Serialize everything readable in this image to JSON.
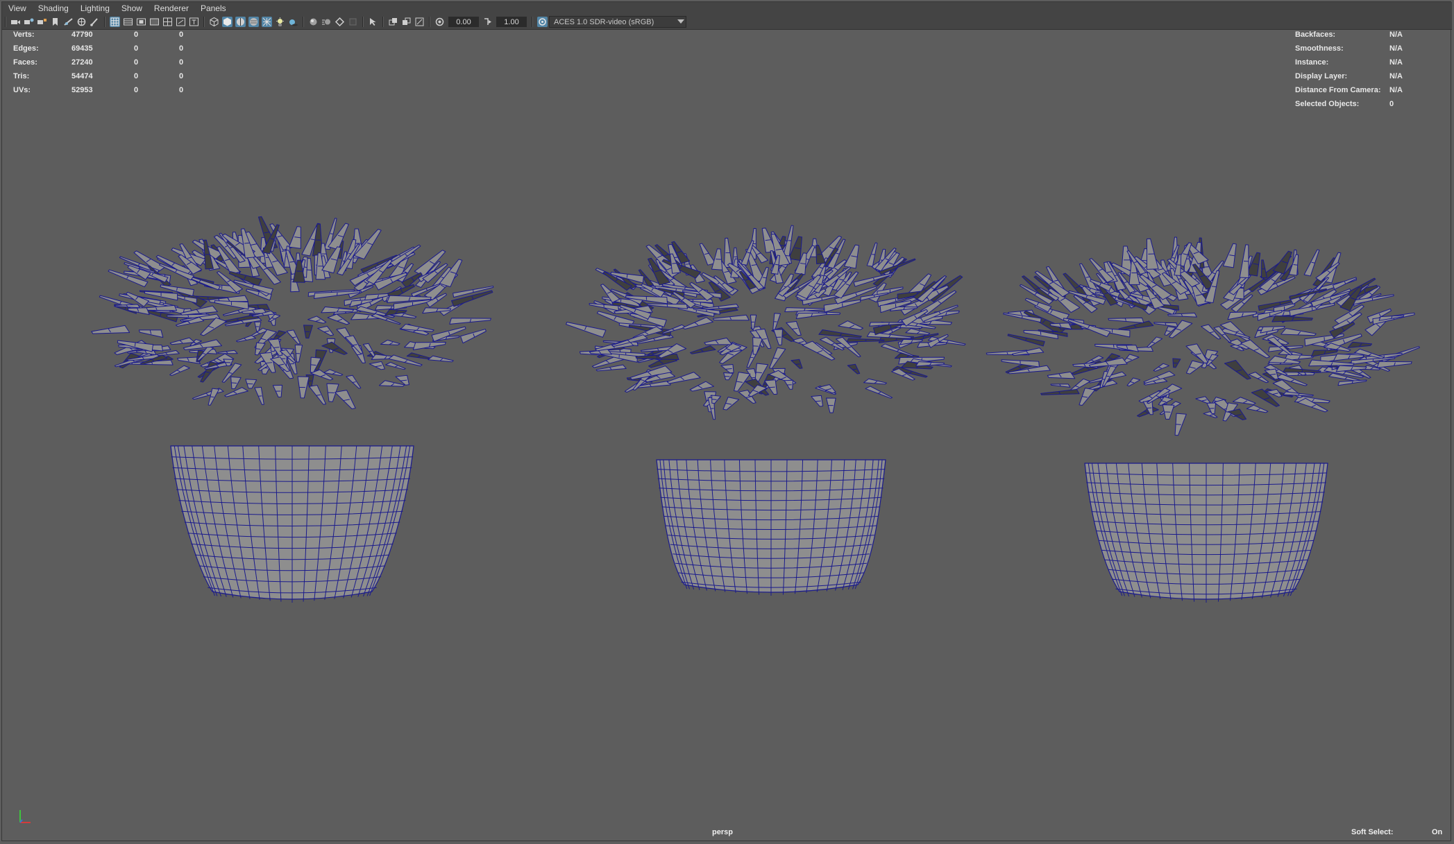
{
  "menu": [
    "View",
    "Shading",
    "Lighting",
    "Show",
    "Renderer",
    "Panels"
  ],
  "toolbar": {
    "exposure": "0.00",
    "gamma": "1.00",
    "color_management": "ACES 1.0 SDR-video (sRGB)",
    "icons": [
      "camera-icon",
      "camera-attributes-icon",
      "bookmark-icon",
      "image-plane-icon",
      "grid-icon",
      "film-gate-icon",
      "resolution-gate-icon",
      "wireframe-icon",
      "smooth-shade-icon",
      "textured-icon",
      "lighting-icon",
      "shadows-icon",
      "isolate-select-icon",
      "xray-icon",
      "exposure-icon",
      "gamma-icon",
      "color-management-icon"
    ]
  },
  "hud_left": [
    {
      "label": "Verts:",
      "v1": "47790",
      "v2": "0",
      "v3": "0"
    },
    {
      "label": "Edges:",
      "v1": "69435",
      "v2": "0",
      "v3": "0"
    },
    {
      "label": "Faces:",
      "v1": "27240",
      "v2": "0",
      "v3": "0"
    },
    {
      "label": "Tris:",
      "v1": "54474",
      "v2": "0",
      "v3": "0"
    },
    {
      "label": "UVs:",
      "v1": "52953",
      "v2": "0",
      "v3": "0"
    }
  ],
  "hud_right": [
    {
      "label": "Backfaces:",
      "value": "N/A"
    },
    {
      "label": "Smoothness:",
      "value": "N/A"
    },
    {
      "label": "Instance:",
      "value": "N/A"
    },
    {
      "label": "Display Layer:",
      "value": "N/A"
    },
    {
      "label": "Distance From Camera:",
      "value": "N/A"
    },
    {
      "label": "Selected Objects:",
      "value": "0"
    }
  ],
  "camera": "persp",
  "soft_select": {
    "label": "Soft Select:",
    "value": "On"
  },
  "colors": {
    "viewport_bg": "#5d5d5d",
    "mesh_fill": "#8e8e8e",
    "mesh_shadow": "#3f3f3f",
    "wireframe": "#1a1a8c",
    "active_button": "#5285a6"
  },
  "models": [
    "plant-pot-model",
    "plant-pot-model",
    "plant-pot-model"
  ]
}
